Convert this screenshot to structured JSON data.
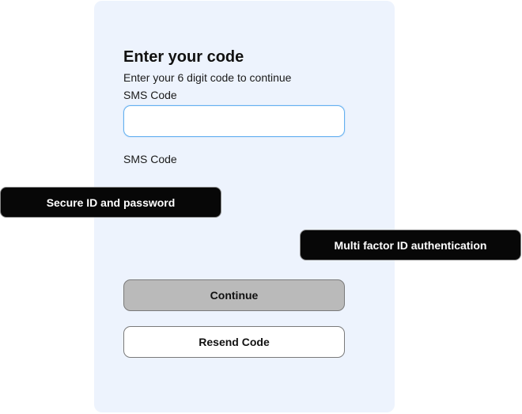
{
  "heading": {
    "title": "Enter your code",
    "subtitle": "Enter your 6 digit code to continue"
  },
  "form": {
    "sms_label": "SMS Code",
    "sms_value": "",
    "second_label": "SMS Code"
  },
  "actions": {
    "continue_label": "Continue",
    "resend_label": "Resend Code"
  },
  "callouts": {
    "secure_id": "Secure ID and password",
    "mfa": "Multi factor ID authentication"
  },
  "colors": {
    "card_background": "#edf3fd",
    "input_focus_border": "#64b0f0",
    "continue_button": "#bababa",
    "callout_background": "#070707"
  }
}
